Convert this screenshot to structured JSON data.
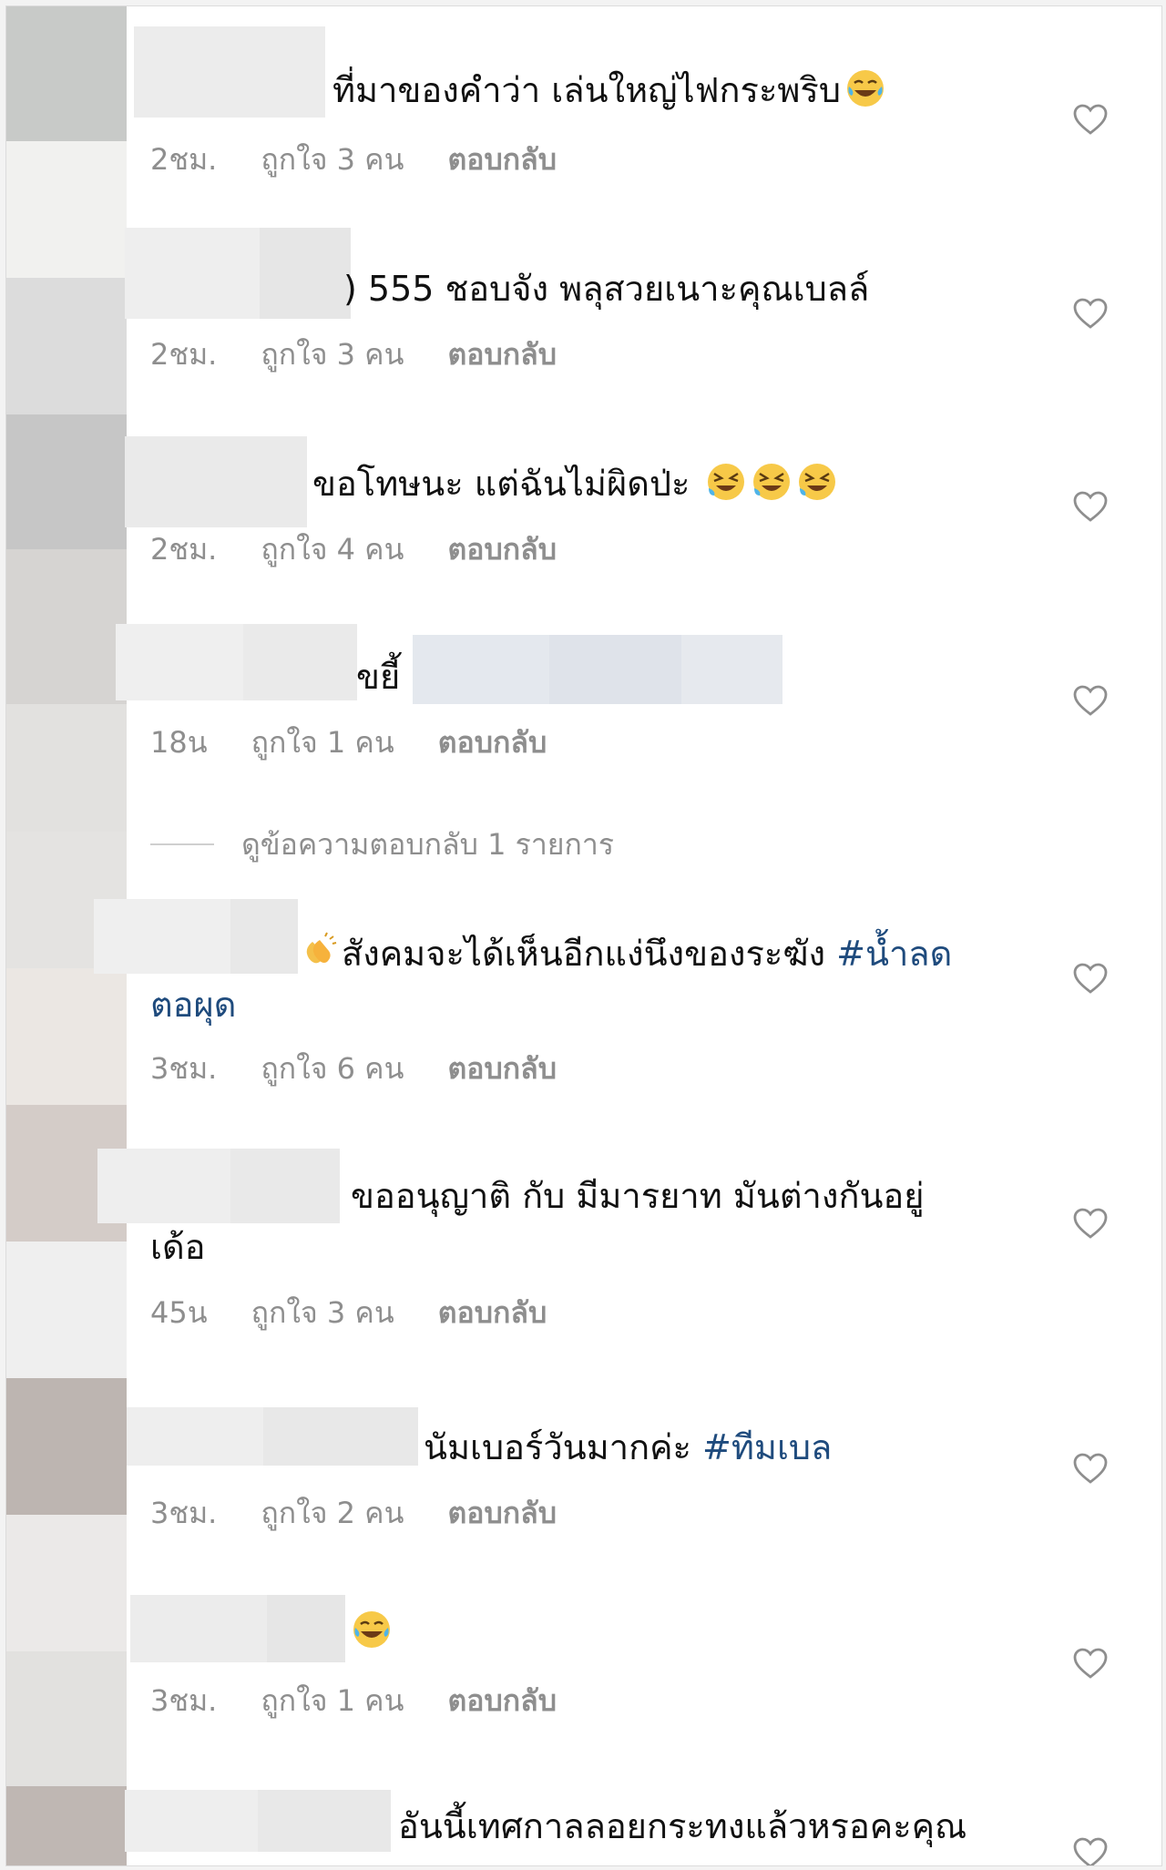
{
  "colors": {
    "text": "#111111",
    "meta": "#8e8e8e",
    "hashtag": "#1f4b7d",
    "heart": "#8e8e8e"
  },
  "comments": [
    {
      "text": "ที่มาของคำว่า เล่นใหญ่ไฟกระพริบ",
      "emoji": "tears-of-joy",
      "time": "2ชม.",
      "likes": "ถูกใจ 3 คน",
      "reply": "ตอบกลับ"
    },
    {
      "text": ") 555 ชอบจัง พลุสวยเนาะคุณเบลล์",
      "time": "2ชม.",
      "likes": "ถูกใจ 3 คน",
      "reply": "ตอบกลับ"
    },
    {
      "text": "ขอโทษนะ แต่ฉันไม่ผิดป่ะ",
      "emoji": "rolling-on-floor-laughing",
      "time": "2ชม.",
      "likes": "ถูกใจ 4 คน",
      "reply": "ตอบกลับ"
    },
    {
      "text": "ขยี้",
      "time": "18น",
      "likes": "ถูกใจ 1 คน",
      "reply": "ตอบกลับ",
      "view_replies": "ดูข้อความตอบกลับ 1 รายการ"
    },
    {
      "text": "สังคมจะได้เห็นอีกแง่นึงของระฆัง",
      "emoji": "clapping-hands",
      "hashtag_part1": "#น้ำลด",
      "hashtag_part2": "ตอผุด",
      "time": "3ชม.",
      "likes": "ถูกใจ 6 คน",
      "reply": "ตอบกลับ"
    },
    {
      "text": "ขออนุญาติ กับ มีมารยาท มันต่างกันอยู่",
      "text_line2": "เด้อ",
      "time": "45น",
      "likes": "ถูกใจ 3 คน",
      "reply": "ตอบกลับ"
    },
    {
      "text": "นัมเบอร์วันมากค่ะ",
      "hashtag": "#ทีมเบล",
      "time": "3ชม.",
      "likes": "ถูกใจ 2 คน",
      "reply": "ตอบกลับ"
    },
    {
      "text": "",
      "emoji": "tears-of-joy",
      "time": "3ชม.",
      "likes": "ถูกใจ 1 คน",
      "reply": "ตอบกลับ"
    },
    {
      "text": "อันนี้เทศกาลลอยกระทงแล้วหรอคะคุณ"
    }
  ]
}
